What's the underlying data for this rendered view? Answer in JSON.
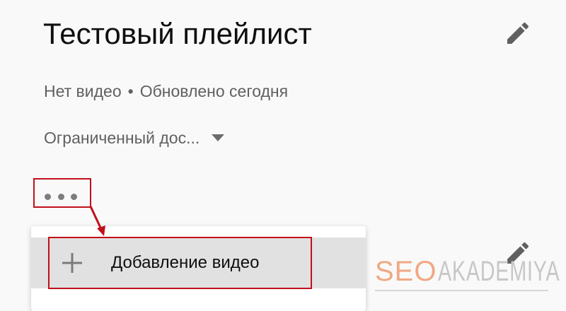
{
  "playlist": {
    "title": "Тестовый плейлист",
    "video_count": "Нет видео",
    "separator": "•",
    "updated": "Обновлено сегодня",
    "privacy": "Ограниченный дос..."
  },
  "icons": {
    "edit_title": "pencil-icon",
    "edit_description": "pencil-icon",
    "more": "more-horizontal-icon",
    "add": "plus-icon",
    "privacy_caret": "caret-down-icon"
  },
  "menu": {
    "items": [
      {
        "label": "Добавление видео",
        "icon": "plus-icon"
      }
    ]
  },
  "annotation": {
    "highlight_color": "#c0101a"
  },
  "watermark": {
    "part1": "SEO",
    "part2": "AKADEMIYA",
    "part1_color": "#f0a883",
    "part2_color": "#c7c7c7"
  }
}
